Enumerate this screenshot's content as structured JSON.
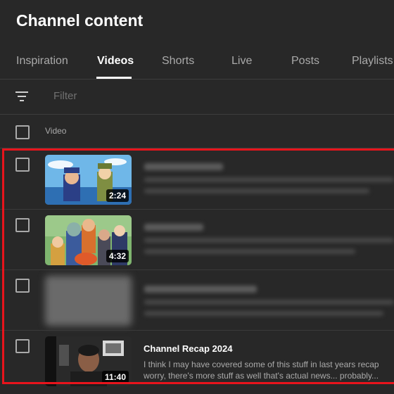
{
  "header": {
    "title": "Channel content"
  },
  "tabs": [
    {
      "label": "Inspiration",
      "active": false
    },
    {
      "label": "Videos",
      "active": true
    },
    {
      "label": "Shorts",
      "active": false
    },
    {
      "label": "Live",
      "active": false
    },
    {
      "label": "Posts",
      "active": false
    },
    {
      "label": "Playlists",
      "active": false
    }
  ],
  "filter": {
    "icon": "filter-icon",
    "placeholder": "Filter"
  },
  "table": {
    "column_video": "Video"
  },
  "videos": [
    {
      "duration": "2:24",
      "title_blurred": true
    },
    {
      "duration": "4:32",
      "title_blurred": true
    },
    {
      "duration": "",
      "title_blurred": true
    },
    {
      "duration": "11:40",
      "title": "Channel Recap 2024",
      "description_line1": "I think I may have covered some of this stuff in last years recap",
      "description_line2": "worry, there's more stuff as well that's actual news... probably..."
    }
  ],
  "colors": {
    "background": "#282828",
    "highlight_border": "#e8141c",
    "text_primary": "#ffffff",
    "text_secondary": "#aaaaaa"
  }
}
